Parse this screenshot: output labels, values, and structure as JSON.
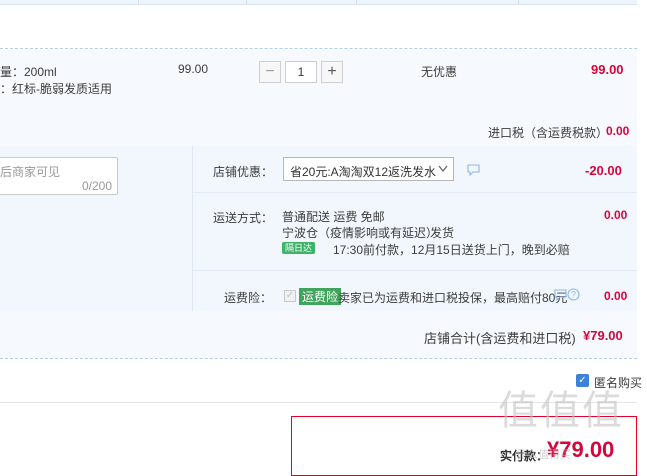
{
  "item": {
    "spec_capacity": "量：200ml",
    "spec_desc": "：红标-脆弱发质适用",
    "unit_price": "99.00",
    "quantity": "1",
    "discount": "无优惠",
    "subtotal": "99.00",
    "minus_sign": "−",
    "plus_sign": "+"
  },
  "import_tax": {
    "label": "进口税（含运费税款）",
    "value": "0.00"
  },
  "message": {
    "placeholder_visible": "后商家可见",
    "counter": "0/200"
  },
  "shop_discount": {
    "label": "店铺优惠：",
    "selected": "省20元:A淘淘双12返洗发水",
    "amount": "-20.00"
  },
  "shipping": {
    "label": "运送方式：",
    "method": "普通配送 运费 免邮",
    "origin": "宁波仓（疫情影响或有延迟）",
    "dispatch": "发货",
    "badge": "隔日达",
    "delivery_note": "17:30前付款，12月15日送货上门，晚到必赔",
    "amount": "0.00"
  },
  "insurance": {
    "label": "运费险：",
    "tag": "运费险",
    "desc": "卖家已为运费和进口税投保，最高赔付80元",
    "amount": "0.00"
  },
  "shop_total": {
    "label": "店铺合计(含运费和进口税)",
    "amount": "¥79.00"
  },
  "anonymous": {
    "label": "匿名购买"
  },
  "payment": {
    "label": "实付款：",
    "amount": "¥79.00"
  },
  "watermark": {
    "text": "值值值",
    "url": "什么值得买"
  },
  "colors": {
    "price_red": "#d6063a",
    "row_bg": "#f2f7fd",
    "accent_blue": "#3b82d8",
    "tag_green": "#41a45c"
  }
}
